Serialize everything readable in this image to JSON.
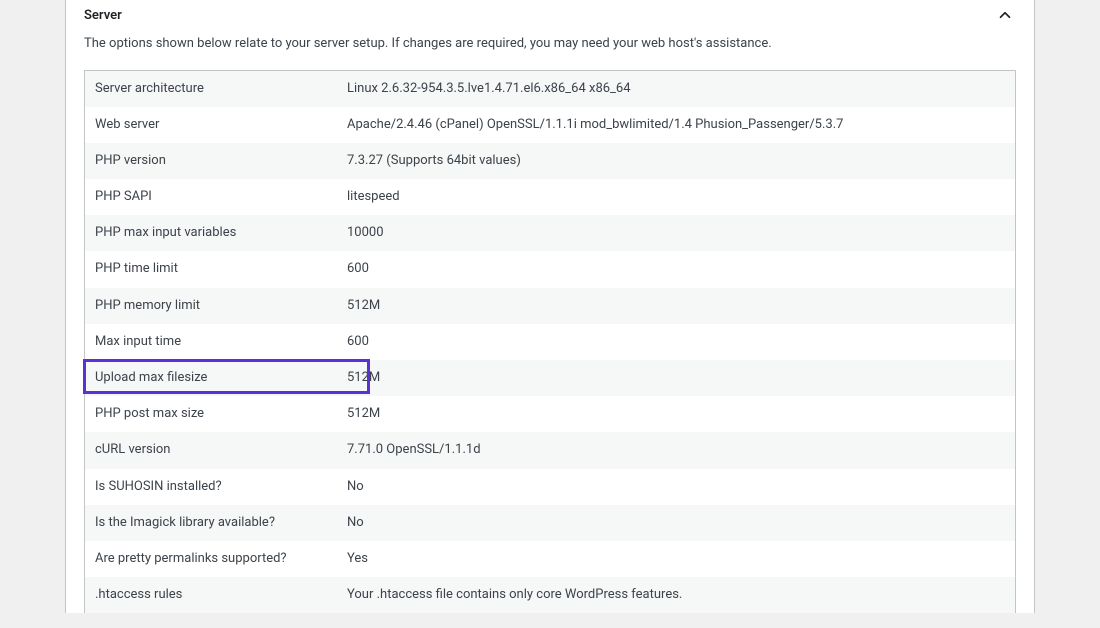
{
  "section": {
    "title": "Server",
    "description": "The options shown below relate to your server setup. If changes are required, you may need your web host's assistance."
  },
  "rows": [
    {
      "label": "Server architecture",
      "value": "Linux 2.6.32-954.3.5.lve1.4.71.el6.x86_64 x86_64"
    },
    {
      "label": "Web server",
      "value": "Apache/2.4.46 (cPanel) OpenSSL/1.1.1i mod_bwlimited/1.4 Phusion_Passenger/5.3.7"
    },
    {
      "label": "PHP version",
      "value": "7.3.27 (Supports 64bit values)"
    },
    {
      "label": "PHP SAPI",
      "value": "litespeed"
    },
    {
      "label": "PHP max input variables",
      "value": "10000"
    },
    {
      "label": "PHP time limit",
      "value": "600"
    },
    {
      "label": "PHP memory limit",
      "value": "512M"
    },
    {
      "label": "Max input time",
      "value": "600"
    },
    {
      "label": "Upload max filesize",
      "value": "512M"
    },
    {
      "label": "PHP post max size",
      "value": "512M"
    },
    {
      "label": "cURL version",
      "value": "7.71.0 OpenSSL/1.1.1d"
    },
    {
      "label": "Is SUHOSIN installed?",
      "value": "No"
    },
    {
      "label": "Is the Imagick library available?",
      "value": "No"
    },
    {
      "label": "Are pretty permalinks supported?",
      "value": "Yes"
    },
    {
      "label": ".htaccess rules",
      "value": "Your .htaccess file contains only core WordPress features."
    }
  ],
  "highlighted_row_index": 8
}
